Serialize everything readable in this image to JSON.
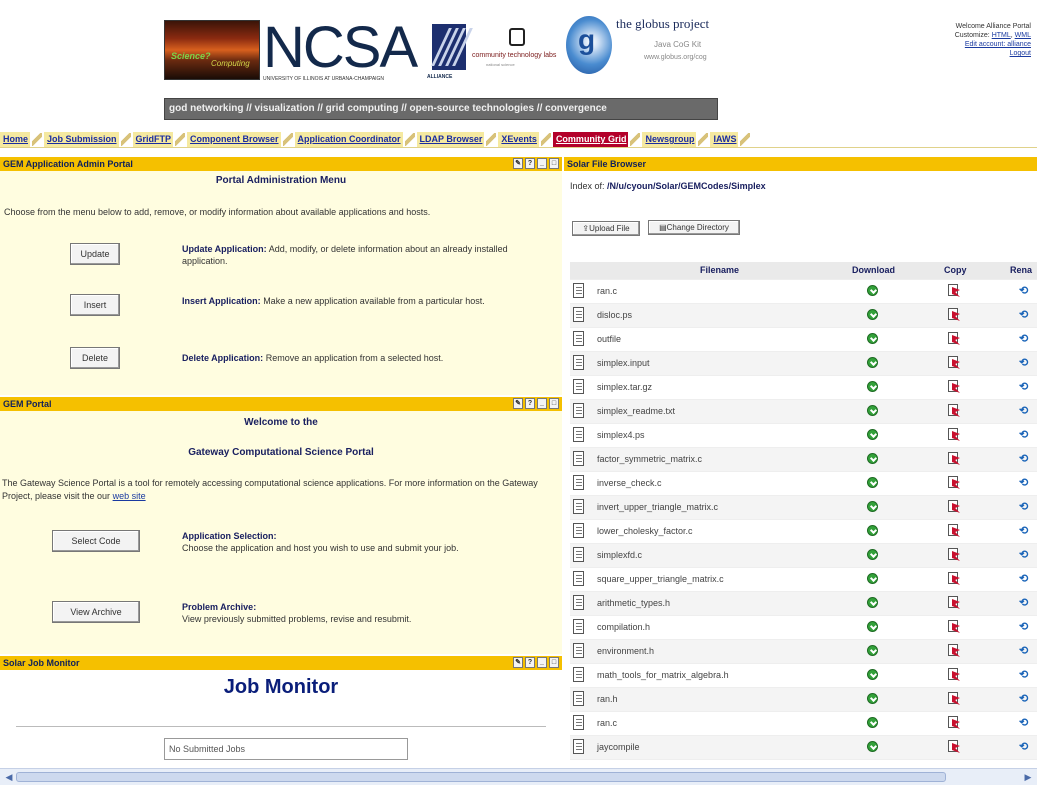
{
  "header": {
    "sunset_logo_text": [
      "Science?",
      "Computing"
    ],
    "ncsa": "NCSA",
    "ncsa_sub": "UNIVERSITY OF ILLINOIS AT URBANA-CHAMPAIGN",
    "alliance": "ALLIANCE",
    "comm_logo": "community technology labs",
    "comm_logo_sub": "national science",
    "globus_title": "the globus project",
    "globus_sub1": "Java CoG Kit",
    "globus_sub2": "www.globus.org/cog",
    "tagline": "god networking // visualization // grid computing // open-source technologies // convergence",
    "welcome": "Welcome Alliance Portal",
    "customize_label": "Customize:",
    "customize_links": [
      "HTML",
      "WML"
    ],
    "edit_account": "Edit account: alliance",
    "logout": "Logout"
  },
  "nav": {
    "tabs": [
      "Home",
      "Job Submission",
      "GridFTP",
      "Component Browser",
      "Application Coordinator",
      "LDAP Browser",
      "XEvents",
      "Community Grid",
      "Newsgroup",
      "IAWS"
    ],
    "active_index": 7
  },
  "admin_portal": {
    "title": "GEM Application Admin Portal",
    "heading": "Portal Administration Menu",
    "intro": "Choose from the menu below to add, remove, or modify information about available applications and hosts.",
    "options": [
      {
        "button": "Update",
        "title": "Update Application:",
        "desc": "Add, modify, or delete information about an already installed application."
      },
      {
        "button": "Insert",
        "title": "Insert Application:",
        "desc": "Make a new application available from a particular host."
      },
      {
        "button": "Delete",
        "title": "Delete Application:",
        "desc": "Remove an application from a selected host."
      }
    ]
  },
  "gem_portal": {
    "title": "GEM Portal",
    "welcome": "Welcome to the",
    "heading": "Gateway Computational Science Portal",
    "intro": "The Gateway Science Portal is a tool for remotely accessing computational science applications.   For more information on the Gateway Project, please visit the our",
    "link": "web site",
    "options": [
      {
        "button": "Select Code",
        "title": "Application Selection:",
        "desc": "Choose the application and host you wish to use and submit your job."
      },
      {
        "button": "View Archive",
        "title": "Problem Archive:",
        "desc": "View previously submitted problems, revise and resubmit."
      }
    ]
  },
  "job_monitor": {
    "title": "Solar Job Monitor",
    "heading": "Job Monitor",
    "field_value": "No Submitted Jobs"
  },
  "file_browser": {
    "title": "Solar File Browser",
    "index_label": "Index of:",
    "path": "/N/u/cyoun/Solar/GEMCodes/Simplex",
    "upload_button": "Upload File",
    "change_dir_button": "Change Directory",
    "columns": [
      "Filename",
      "Download",
      "Copy",
      "Rena"
    ],
    "files": [
      "ran.c",
      "disloc.ps",
      "outfile",
      "simplex.input",
      "simplex.tar.gz",
      "simplex_readme.txt",
      "simplex4.ps",
      "factor_symmetric_matrix.c",
      "inverse_check.c",
      "invert_upper_triangle_matrix.c",
      "lower_cholesky_factor.c",
      "simplexfd.c",
      "square_upper_triangle_matrix.c",
      "arithmetic_types.h",
      "compilation.h",
      "environment.h",
      "math_tools_for_matrix_algebra.h",
      "ran.h",
      "ran.c",
      "jaycompile"
    ]
  }
}
